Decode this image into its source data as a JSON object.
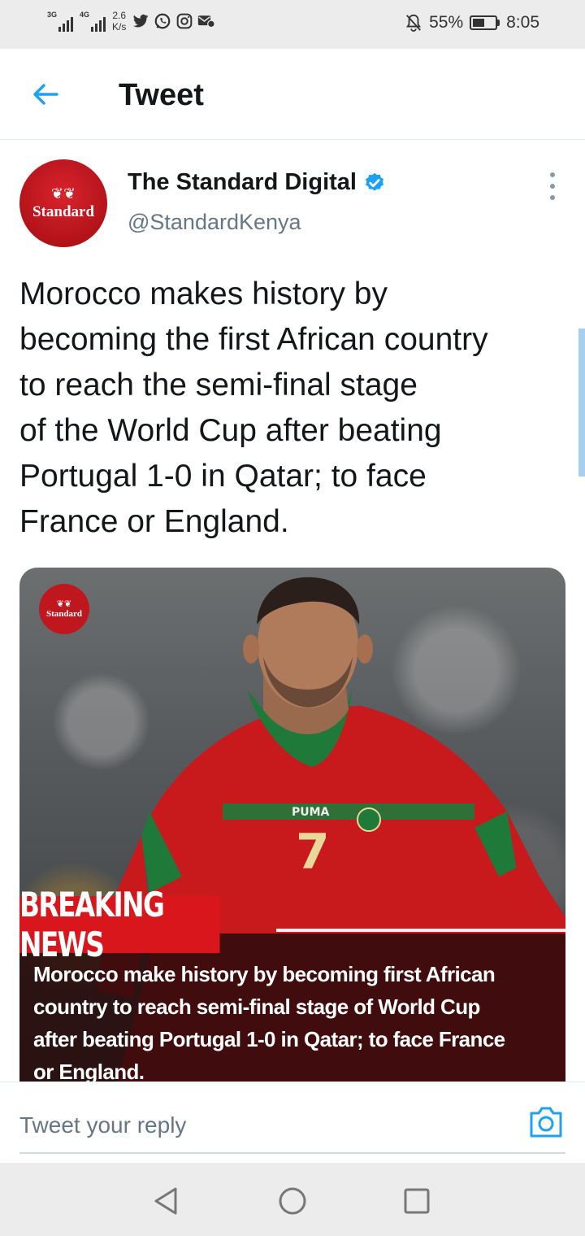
{
  "status_bar": {
    "signal1_label": "3G",
    "signal2_label": "4G",
    "speed_value": "2.6",
    "speed_unit": "K/s",
    "battery_percent": "55%",
    "battery_level": 0.55,
    "time": "8:05",
    "notification_icons": [
      "twitter-icon",
      "whatsapp-icon",
      "instagram-icon",
      "mail-icon"
    ]
  },
  "header": {
    "title": "Tweet"
  },
  "tweet": {
    "author_name": "The Standard Digital",
    "handle": "@StandardKenya",
    "avatar_text": "Standard",
    "text_lines": [
      "Morocco makes history by",
      "becoming the first African country",
      "to reach the semi-final stage",
      "of the World Cup after beating",
      "Portugal 1-0 in Qatar; to face",
      "France or England."
    ],
    "media": {
      "logo_text": "Standard",
      "tag": "BREAKING NEWS",
      "headline_lines": [
        "Morocco make history by becoming first African",
        "country to reach semi-final stage of World Cup",
        "after beating Portugal 1-0 in Qatar; to face France",
        "or England."
      ]
    }
  },
  "reply": {
    "placeholder": "Tweet your reply"
  },
  "colors": {
    "accent": "#1da1f2",
    "brand_red": "#c0171f",
    "text": "#14171a",
    "secondary_text": "#657786"
  }
}
